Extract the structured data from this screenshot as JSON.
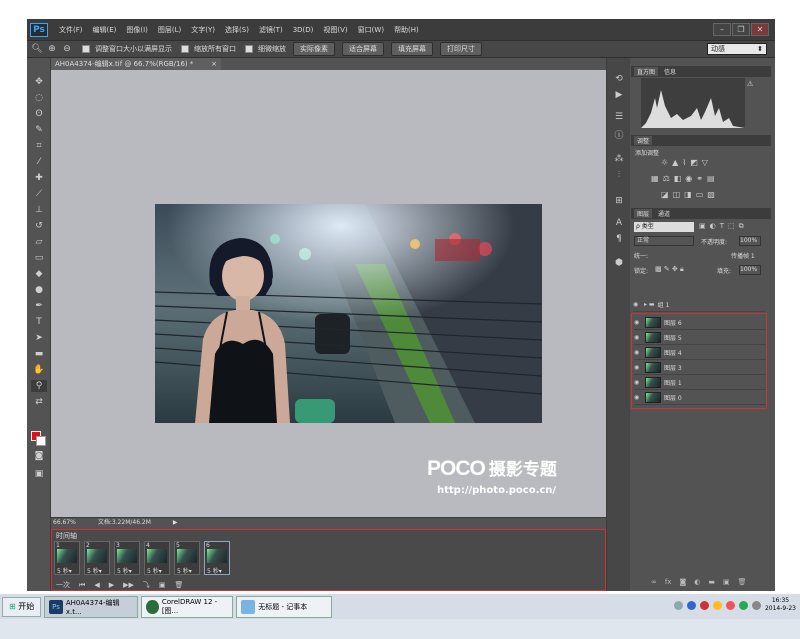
{
  "app": {
    "logo": "Ps",
    "menu": [
      "文件(F)",
      "编辑(E)",
      "图像(I)",
      "图层(L)",
      "文字(Y)",
      "选择(S)",
      "滤镜(T)",
      "3D(D)",
      "视图(V)",
      "窗口(W)",
      "帮助(H)"
    ]
  },
  "options_bar": {
    "check1": "调整窗口大小以满屏显示",
    "check2": "缩放所有窗口",
    "check3": "细微缩放",
    "btn_actual": "实际像素",
    "btn_fit": "适合屏幕",
    "btn_fill": "填充屏幕",
    "btn_print": "打印尺寸",
    "workspace": "动感"
  },
  "document": {
    "tab_title": "AH0A4374-编辑x.tif @ 66.7%(RGB/16) *",
    "zoom": "66.67%",
    "doc_size": "文档:3.22M/46.2M"
  },
  "watermark": {
    "logo": "POCO",
    "title": "摄影专题",
    "url": "http://photo.poco.cn/"
  },
  "timeline": {
    "title": "时间轴",
    "frames": [
      {
        "num": "1",
        "delay": "5 秒▾"
      },
      {
        "num": "2",
        "delay": "5 秒▾"
      },
      {
        "num": "3",
        "delay": "5 秒▾"
      },
      {
        "num": "4",
        "delay": "5 秒▾"
      },
      {
        "num": "5",
        "delay": "5 秒▾"
      },
      {
        "num": "6",
        "delay": "5 秒▾"
      }
    ],
    "loop": "一次"
  },
  "panels": {
    "histogram_tabs": [
      "直方图",
      "信息"
    ],
    "adjust_tab": "调整",
    "adjust_add": "添加调整",
    "layers_tabs": [
      "图层",
      "通道"
    ],
    "filter_kind": "ρ 类型",
    "blend_mode": "正常",
    "opacity_label": "不透明度:",
    "opacity_value": "100%",
    "unify_label": "统一:",
    "propagate_label": "传播帧 1",
    "lock_label": "锁定:",
    "fill_label": "填充:",
    "fill_value": "100%",
    "group_name": "组 1",
    "layers": [
      "图层 6",
      "图层 5",
      "图层 4",
      "图层 3",
      "图层 1",
      "图层 0"
    ]
  },
  "taskbar": {
    "start": "开始",
    "tasks": [
      "AH0A4374-编辑x.t...",
      "CorelDRAW 12 - [图...",
      "无标题 - 记事本"
    ],
    "time": "16:35",
    "date": "2014-9-23"
  }
}
